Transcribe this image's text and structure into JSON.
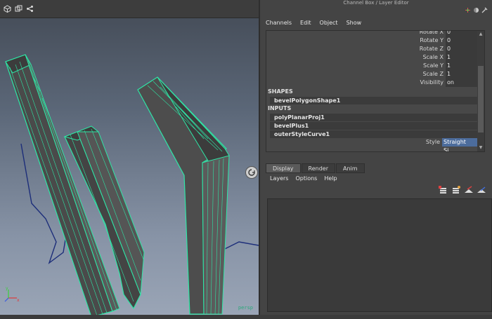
{
  "window": {
    "title": "Channel Box / Layer Editor"
  },
  "viewport": {
    "toolbar_icons": [
      "cube-icon",
      "layers-icon",
      "share-icon"
    ],
    "status_label": "persp"
  },
  "channel_box": {
    "menu": [
      "Channels",
      "Edit",
      "Object",
      "Show"
    ],
    "attributes": [
      {
        "label": "Rotate X",
        "value": "0"
      },
      {
        "label": "Rotate Y",
        "value": "0"
      },
      {
        "label": "Rotate Z",
        "value": "0"
      },
      {
        "label": "Scale X",
        "value": "1"
      },
      {
        "label": "Scale Y",
        "value": "1"
      },
      {
        "label": "Scale Z",
        "value": "1"
      },
      {
        "label": "Visibility",
        "value": "on"
      }
    ],
    "shapes_header": "SHAPES",
    "shapes": [
      "bevelPolygonShape1"
    ],
    "inputs_header": "INPUTS",
    "inputs": [
      "polyPlanarProj1",
      "bevelPlus1",
      "outerStyleCurve1"
    ],
    "style_label": "Style",
    "style_value": "Straight Si..."
  },
  "layer_editor": {
    "tabs": [
      {
        "label": "Display",
        "active": true
      },
      {
        "label": "Render",
        "active": false
      },
      {
        "label": "Anim",
        "active": false
      }
    ],
    "menu": [
      "Layers",
      "Options",
      "Help"
    ],
    "icons": [
      "new-layer-icon",
      "new-layer-selected-icon",
      "move-layer-up-icon",
      "move-layer-down-icon"
    ]
  },
  "colors": {
    "wire": "#2ee6a6",
    "face": "#4e4e4e",
    "selection": "#4c6c9c"
  }
}
